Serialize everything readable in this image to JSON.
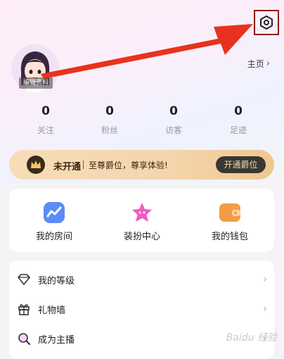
{
  "profile": {
    "avatar_tag": "编辑资料",
    "homepage_label": "主页"
  },
  "stats": [
    {
      "count": "0",
      "label": "关注"
    },
    {
      "count": "0",
      "label": "粉丝"
    },
    {
      "count": "0",
      "label": "访客"
    },
    {
      "count": "0",
      "label": "足迹"
    }
  ],
  "vip": {
    "status": "未开通",
    "description": "至尊爵位，尊享体验!",
    "button": "开通爵位"
  },
  "shortcuts": [
    {
      "label": "我的房间",
      "icon": "chart-room-icon"
    },
    {
      "label": "装扮中心",
      "icon": "star-decor-icon"
    },
    {
      "label": "我的钱包",
      "icon": "wallet-icon"
    }
  ],
  "menu": [
    {
      "label": "我的等级",
      "icon": "diamond-icon"
    },
    {
      "label": "礼物墙",
      "icon": "gift-icon"
    },
    {
      "label": "成为主播",
      "icon": "search-icon"
    }
  ],
  "colors": {
    "annotation_arrow": "#e8321e",
    "annotation_box": "#8e1b1b",
    "vip_gold": "#f4d5ad"
  }
}
